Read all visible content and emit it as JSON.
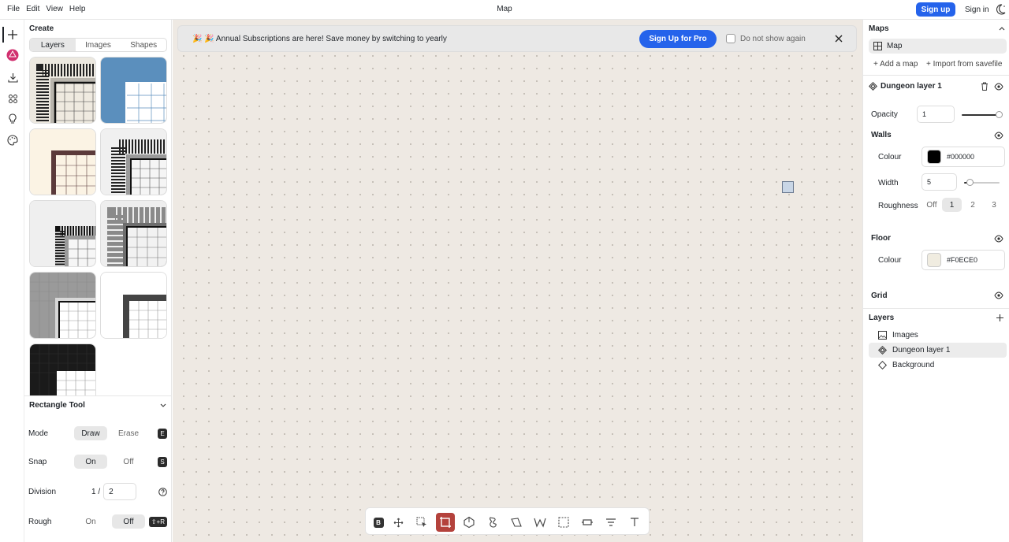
{
  "menu": {
    "file": "File",
    "edit": "Edit",
    "view": "View",
    "help": "Help"
  },
  "app_title": "Map",
  "auth": {
    "signup": "Sign up",
    "signin": "Sign in"
  },
  "left": {
    "title": "Create",
    "tabs": [
      "Layers",
      "Images",
      "Shapes"
    ],
    "tool": {
      "name": "Rectangle Tool",
      "mode": {
        "label": "Mode",
        "draw": "Draw",
        "erase": "Erase",
        "key": "E"
      },
      "snap": {
        "label": "Snap",
        "on": "On",
        "off": "Off",
        "key": "S"
      },
      "division": {
        "label": "Division",
        "prefix": "1 /",
        "value": "2"
      },
      "rough": {
        "label": "Rough",
        "on": "On",
        "off": "Off",
        "key": "⇧+R"
      }
    }
  },
  "banner": {
    "text": "🎉 🎉 Annual Subscriptions are here! Save money by switching to yearly",
    "cta": "Sign Up for Pro",
    "checkbox": "Do not show again"
  },
  "right": {
    "maps_title": "Maps",
    "map_item": "Map",
    "add_map": "+ Add a map",
    "import": "+ Import from savefile",
    "layer_title": "Dungeon layer 1",
    "opacity": {
      "label": "Opacity",
      "value": "1",
      "level": 1
    },
    "walls": {
      "title": "Walls",
      "colour_label": "Colour",
      "colour": "#000000",
      "width_label": "Width",
      "width": "5",
      "width_level": 0.1,
      "roughness_label": "Roughness",
      "roughness": [
        "Off",
        "1",
        "2",
        "3"
      ],
      "roughness_selected": "1"
    },
    "floor": {
      "title": "Floor",
      "colour_label": "Colour",
      "colour": "#F0ECE0"
    },
    "grid_title": "Grid",
    "layers_title": "Layers",
    "layers": [
      "Images",
      "Dungeon layer 1",
      "Background"
    ]
  },
  "colors": {
    "accent": "#2563eb",
    "selected_tool": "#b4423c",
    "canvas": "#eee9e3"
  }
}
